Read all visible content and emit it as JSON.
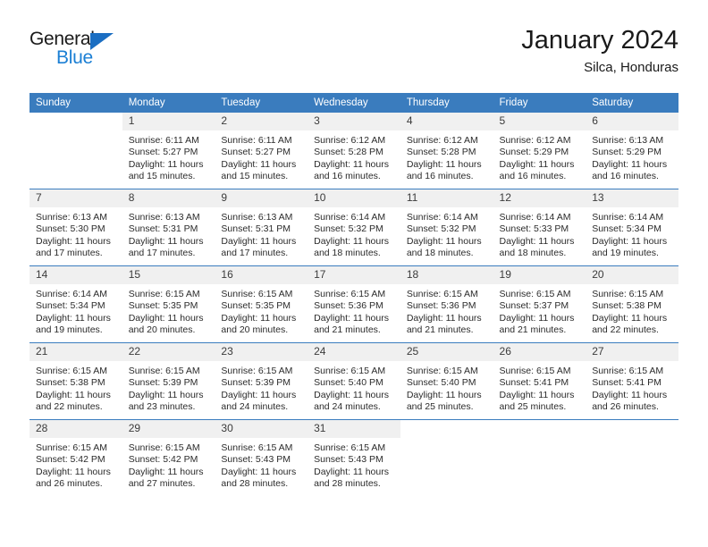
{
  "brand": {
    "name_top": "General",
    "name_bottom": "Blue",
    "accent_color": "#1b7fd4",
    "triangle_color": "#1b6ec2"
  },
  "header": {
    "title": "January 2024",
    "subtitle": "Silca, Honduras"
  },
  "theme": {
    "header_row_background": "#3a7cbe",
    "header_row_text": "#ffffff",
    "daynum_band_background": "#f0f0f0",
    "row_separator": "#3a7cbe",
    "body_text": "#2b2b2b"
  },
  "weekdays": [
    "Sunday",
    "Monday",
    "Tuesday",
    "Wednesday",
    "Thursday",
    "Friday",
    "Saturday"
  ],
  "labels": {
    "sunrise_prefix": "Sunrise:",
    "sunset_prefix": "Sunset:",
    "daylight_prefix": "Daylight:"
  },
  "weeks": [
    [
      {
        "day": "",
        "empty": true,
        "blank": true,
        "lines": []
      },
      {
        "day": "1",
        "lines": [
          "Sunrise: 6:11 AM",
          "Sunset: 5:27 PM",
          "Daylight: 11 hours",
          "and 15 minutes."
        ]
      },
      {
        "day": "2",
        "lines": [
          "Sunrise: 6:11 AM",
          "Sunset: 5:27 PM",
          "Daylight: 11 hours",
          "and 15 minutes."
        ]
      },
      {
        "day": "3",
        "lines": [
          "Sunrise: 6:12 AM",
          "Sunset: 5:28 PM",
          "Daylight: 11 hours",
          "and 16 minutes."
        ]
      },
      {
        "day": "4",
        "lines": [
          "Sunrise: 6:12 AM",
          "Sunset: 5:28 PM",
          "Daylight: 11 hours",
          "and 16 minutes."
        ]
      },
      {
        "day": "5",
        "lines": [
          "Sunrise: 6:12 AM",
          "Sunset: 5:29 PM",
          "Daylight: 11 hours",
          "and 16 minutes."
        ]
      },
      {
        "day": "6",
        "lines": [
          "Sunrise: 6:13 AM",
          "Sunset: 5:29 PM",
          "Daylight: 11 hours",
          "and 16 minutes."
        ]
      }
    ],
    [
      {
        "day": "7",
        "lines": [
          "Sunrise: 6:13 AM",
          "Sunset: 5:30 PM",
          "Daylight: 11 hours",
          "and 17 minutes."
        ]
      },
      {
        "day": "8",
        "lines": [
          "Sunrise: 6:13 AM",
          "Sunset: 5:31 PM",
          "Daylight: 11 hours",
          "and 17 minutes."
        ]
      },
      {
        "day": "9",
        "lines": [
          "Sunrise: 6:13 AM",
          "Sunset: 5:31 PM",
          "Daylight: 11 hours",
          "and 17 minutes."
        ]
      },
      {
        "day": "10",
        "lines": [
          "Sunrise: 6:14 AM",
          "Sunset: 5:32 PM",
          "Daylight: 11 hours",
          "and 18 minutes."
        ]
      },
      {
        "day": "11",
        "lines": [
          "Sunrise: 6:14 AM",
          "Sunset: 5:32 PM",
          "Daylight: 11 hours",
          "and 18 minutes."
        ]
      },
      {
        "day": "12",
        "lines": [
          "Sunrise: 6:14 AM",
          "Sunset: 5:33 PM",
          "Daylight: 11 hours",
          "and 18 minutes."
        ]
      },
      {
        "day": "13",
        "lines": [
          "Sunrise: 6:14 AM",
          "Sunset: 5:34 PM",
          "Daylight: 11 hours",
          "and 19 minutes."
        ]
      }
    ],
    [
      {
        "day": "14",
        "lines": [
          "Sunrise: 6:14 AM",
          "Sunset: 5:34 PM",
          "Daylight: 11 hours",
          "and 19 minutes."
        ]
      },
      {
        "day": "15",
        "lines": [
          "Sunrise: 6:15 AM",
          "Sunset: 5:35 PM",
          "Daylight: 11 hours",
          "and 20 minutes."
        ]
      },
      {
        "day": "16",
        "lines": [
          "Sunrise: 6:15 AM",
          "Sunset: 5:35 PM",
          "Daylight: 11 hours",
          "and 20 minutes."
        ]
      },
      {
        "day": "17",
        "lines": [
          "Sunrise: 6:15 AM",
          "Sunset: 5:36 PM",
          "Daylight: 11 hours",
          "and 21 minutes."
        ]
      },
      {
        "day": "18",
        "lines": [
          "Sunrise: 6:15 AM",
          "Sunset: 5:36 PM",
          "Daylight: 11 hours",
          "and 21 minutes."
        ]
      },
      {
        "day": "19",
        "lines": [
          "Sunrise: 6:15 AM",
          "Sunset: 5:37 PM",
          "Daylight: 11 hours",
          "and 21 minutes."
        ]
      },
      {
        "day": "20",
        "lines": [
          "Sunrise: 6:15 AM",
          "Sunset: 5:38 PM",
          "Daylight: 11 hours",
          "and 22 minutes."
        ]
      }
    ],
    [
      {
        "day": "21",
        "lines": [
          "Sunrise: 6:15 AM",
          "Sunset: 5:38 PM",
          "Daylight: 11 hours",
          "and 22 minutes."
        ]
      },
      {
        "day": "22",
        "lines": [
          "Sunrise: 6:15 AM",
          "Sunset: 5:39 PM",
          "Daylight: 11 hours",
          "and 23 minutes."
        ]
      },
      {
        "day": "23",
        "lines": [
          "Sunrise: 6:15 AM",
          "Sunset: 5:39 PM",
          "Daylight: 11 hours",
          "and 24 minutes."
        ]
      },
      {
        "day": "24",
        "lines": [
          "Sunrise: 6:15 AM",
          "Sunset: 5:40 PM",
          "Daylight: 11 hours",
          "and 24 minutes."
        ]
      },
      {
        "day": "25",
        "lines": [
          "Sunrise: 6:15 AM",
          "Sunset: 5:40 PM",
          "Daylight: 11 hours",
          "and 25 minutes."
        ]
      },
      {
        "day": "26",
        "lines": [
          "Sunrise: 6:15 AM",
          "Sunset: 5:41 PM",
          "Daylight: 11 hours",
          "and 25 minutes."
        ]
      },
      {
        "day": "27",
        "lines": [
          "Sunrise: 6:15 AM",
          "Sunset: 5:41 PM",
          "Daylight: 11 hours",
          "and 26 minutes."
        ]
      }
    ],
    [
      {
        "day": "28",
        "lines": [
          "Sunrise: 6:15 AM",
          "Sunset: 5:42 PM",
          "Daylight: 11 hours",
          "and 26 minutes."
        ]
      },
      {
        "day": "29",
        "lines": [
          "Sunrise: 6:15 AM",
          "Sunset: 5:42 PM",
          "Daylight: 11 hours",
          "and 27 minutes."
        ]
      },
      {
        "day": "30",
        "lines": [
          "Sunrise: 6:15 AM",
          "Sunset: 5:43 PM",
          "Daylight: 11 hours",
          "and 28 minutes."
        ]
      },
      {
        "day": "31",
        "lines": [
          "Sunrise: 6:15 AM",
          "Sunset: 5:43 PM",
          "Daylight: 11 hours",
          "and 28 minutes."
        ]
      },
      {
        "day": "",
        "empty": true,
        "blank": true,
        "lines": []
      },
      {
        "day": "",
        "empty": true,
        "blank": true,
        "lines": []
      },
      {
        "day": "",
        "empty": true,
        "blank": true,
        "lines": []
      }
    ]
  ]
}
